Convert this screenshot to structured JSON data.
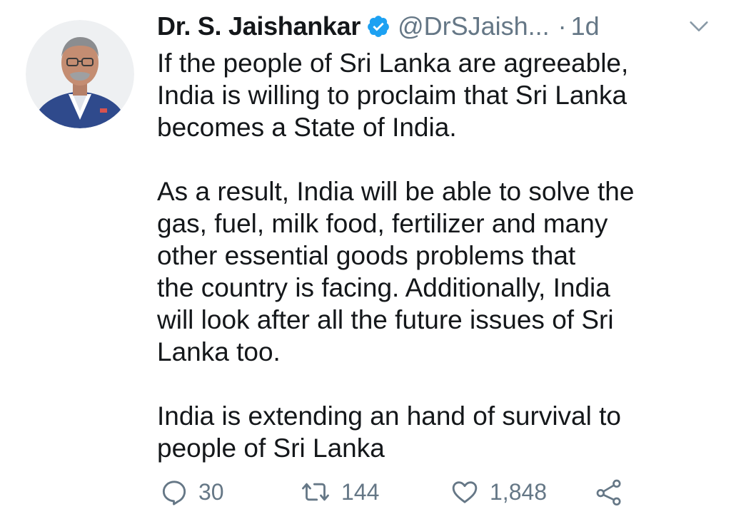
{
  "tweet": {
    "author_name": "Dr. S. Jaishankar",
    "handle": "@DrSJaish...",
    "separator": "·",
    "time": "1d",
    "verified": true,
    "body_paragraphs": [
      [
        "If the people of Sri Lanka are agreeable,",
        "India is willing to proclaim that Sri Lanka",
        "becomes a State of India."
      ],
      [
        "As a result, India will be able to solve the",
        "gas, fuel, milk food, fertilizer and many",
        "other essential goods problems that",
        "the country is facing. Additionally, India",
        "will look after all the future issues of Sri",
        "Lanka too."
      ],
      [
        "India is extending an hand of survival to",
        "people of Sri Lanka"
      ]
    ]
  },
  "actions": {
    "reply_count": "30",
    "retweet_count": "144",
    "like_count": "1,848"
  },
  "icons": {
    "verified": "verified-badge-icon",
    "caret": "chevron-down-icon",
    "reply": "reply-icon",
    "retweet": "retweet-icon",
    "like": "heart-icon",
    "share": "share-icon"
  },
  "colors": {
    "verified_blue": "#1da1f2",
    "text_primary": "#14171a",
    "text_secondary": "#657786"
  }
}
